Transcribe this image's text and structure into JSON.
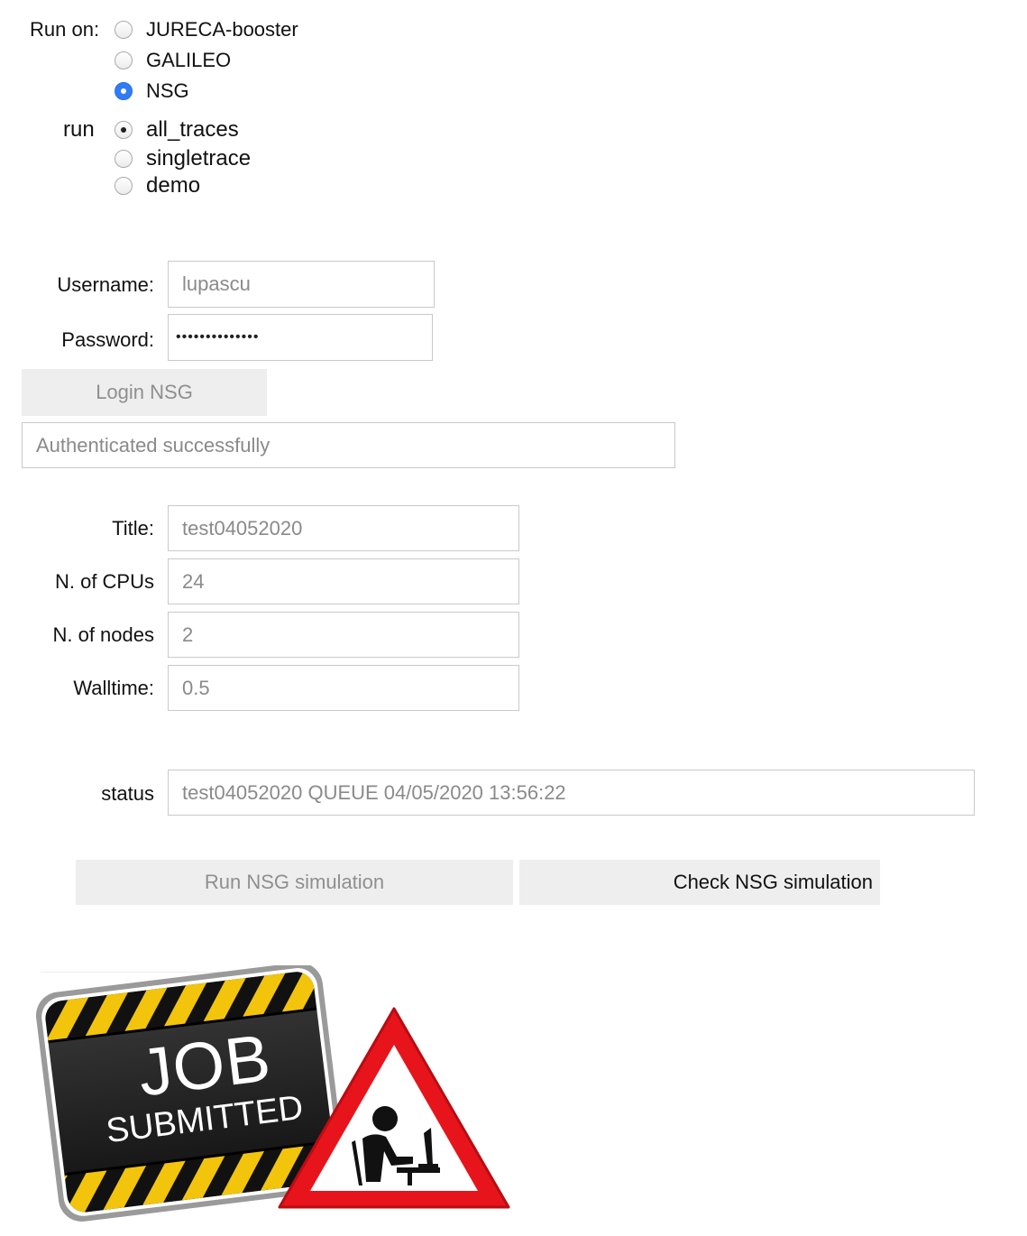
{
  "run_on": {
    "label": "Run on:",
    "options": [
      "JURECA-booster",
      "GALILEO",
      "NSG"
    ]
  },
  "run": {
    "label": "run",
    "options": [
      "all_traces",
      "singletrace",
      "demo"
    ]
  },
  "login": {
    "username_label": "Username:",
    "username_value": "lupascu",
    "password_label": "Password:",
    "password_value": "••••••••••••••",
    "button_label": "Login NSG",
    "auth_message": "Authenticated successfully"
  },
  "job": {
    "title_label": "Title:",
    "title_value": "test04052020",
    "cpus_label": "N. of CPUs",
    "cpus_value": "24",
    "nodes_label": "N. of nodes",
    "nodes_value": "2",
    "walltime_label": "Walltime:",
    "walltime_value": "0.5"
  },
  "status": {
    "label": "status",
    "value": "test04052020 QUEUE 04/05/2020 13:56:22"
  },
  "actions": {
    "run_label": "Run NSG simulation",
    "check_label": "Check NSG simulation"
  },
  "banner": {
    "line1": "JOB",
    "line2": "SUBMITTED"
  },
  "colors": {
    "radio_selected": "#2f7df6",
    "stripe_yellow": "#f2c40c",
    "warning_red": "#e8141b"
  }
}
